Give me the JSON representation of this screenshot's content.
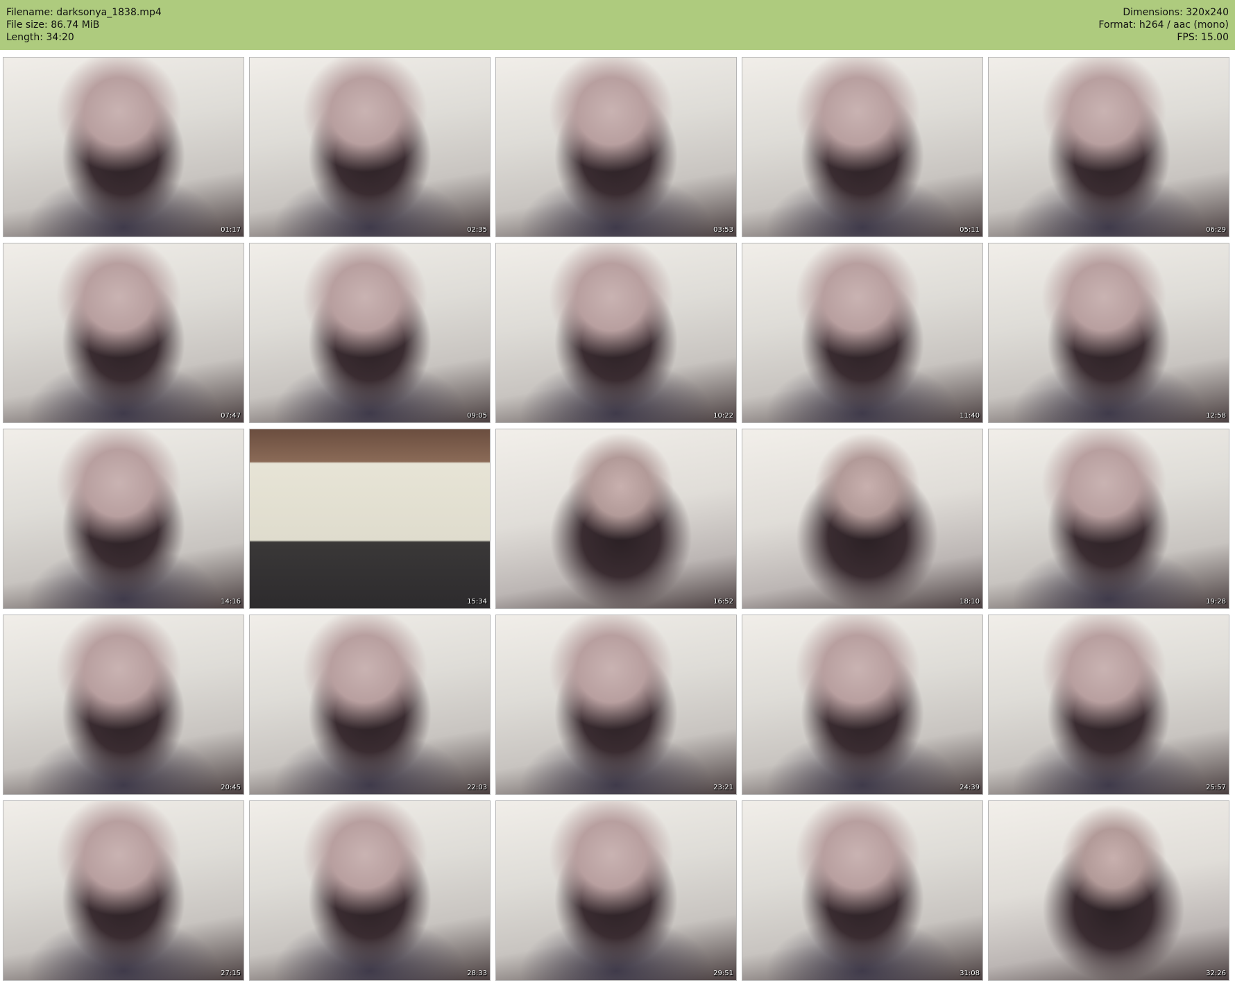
{
  "header": {
    "filename": "Filename: darksonya_1838.mp4",
    "filesize": "File size: 86.74 MiB",
    "length": "Length: 34:20",
    "dimensions": "Dimensions: 320x240",
    "format": "Format: h264 / aac (mono)",
    "fps": "FPS: 15.00"
  },
  "colors": {
    "header_bg": "#aecb7e",
    "page_bg": "#ffffff",
    "thumb_border": "#b5b5b5"
  },
  "thumbnails": [
    {
      "time": "01:17",
      "scene": "person"
    },
    {
      "time": "02:35",
      "scene": "person"
    },
    {
      "time": "03:53",
      "scene": "person"
    },
    {
      "time": "05:11",
      "scene": "person"
    },
    {
      "time": "06:29",
      "scene": "person"
    },
    {
      "time": "07:47",
      "scene": "person"
    },
    {
      "time": "09:05",
      "scene": "person"
    },
    {
      "time": "10:22",
      "scene": "person"
    },
    {
      "time": "11:40",
      "scene": "person"
    },
    {
      "time": "12:58",
      "scene": "person"
    },
    {
      "time": "14:16",
      "scene": "person"
    },
    {
      "time": "15:34",
      "scene": "room"
    },
    {
      "time": "16:52",
      "scene": "wide"
    },
    {
      "time": "18:10",
      "scene": "wide"
    },
    {
      "time": "19:28",
      "scene": "person"
    },
    {
      "time": "20:45",
      "scene": "person"
    },
    {
      "time": "22:03",
      "scene": "person"
    },
    {
      "time": "23:21",
      "scene": "person"
    },
    {
      "time": "24:39",
      "scene": "person"
    },
    {
      "time": "25:57",
      "scene": "person"
    },
    {
      "time": "27:15",
      "scene": "person"
    },
    {
      "time": "28:33",
      "scene": "person"
    },
    {
      "time": "29:51",
      "scene": "person"
    },
    {
      "time": "31:08",
      "scene": "person"
    },
    {
      "time": "32:26",
      "scene": "wide"
    }
  ]
}
